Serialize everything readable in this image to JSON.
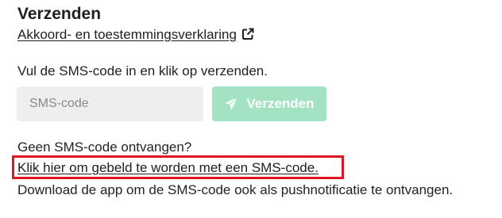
{
  "header": {
    "title": "Verzenden",
    "agreement_link": "Akkoord- en toestemmingsverklaring",
    "agreement_icon": "external-link-icon"
  },
  "form": {
    "instruction": "Vul de SMS-code in en klik op verzenden.",
    "sms_input_placeholder": "SMS-code",
    "sms_input_value": "",
    "send_button_label": "Verzenden",
    "send_button_icon": "paper-plane-icon",
    "send_button_color": "#a3e2c2"
  },
  "help": {
    "no_sms_text": "Geen SMS-code ontvangen?",
    "call_link": "Klik hier om gebeld te worden met een SMS-code.",
    "highlight_color": "#e2141f",
    "download_text": "Download de app om de SMS-code ook als pushnotificatie te ontvangen."
  }
}
